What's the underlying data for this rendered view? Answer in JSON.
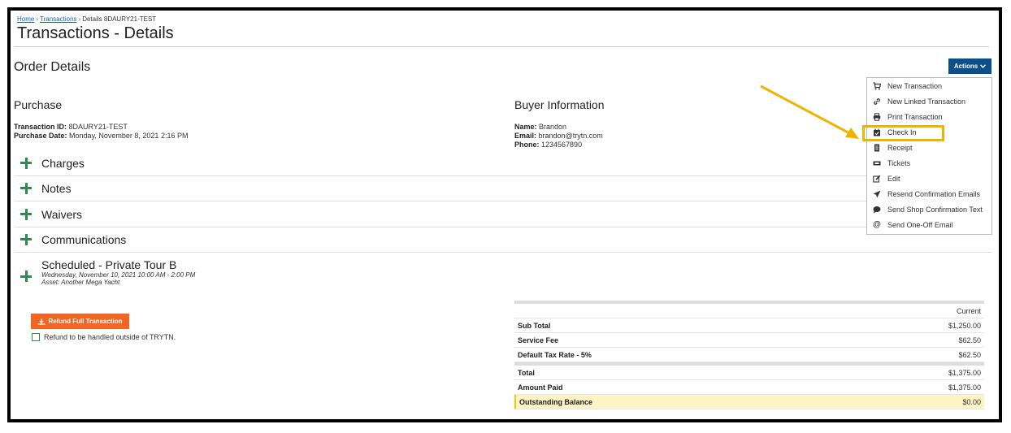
{
  "breadcrumb": {
    "home": "Home",
    "transactions": "Transactions",
    "current": "Details 8DAURY21-TEST"
  },
  "page_title": "Transactions - Details",
  "order_title": "Order Details",
  "actions_label": "Actions",
  "purchase": {
    "title": "Purchase",
    "transaction_id_label": "Transaction ID:",
    "transaction_id": "8DAURY21-TEST",
    "purchase_date_label": "Purchase Date:",
    "purchase_date": "Monday, November 8, 2021 2:16 PM"
  },
  "buyer": {
    "title": "Buyer Information",
    "name_label": "Name:",
    "name": "Brandon",
    "email_label": "Email:",
    "email": "brandon@trytn.com",
    "phone_label": "Phone:",
    "phone": "1234567890"
  },
  "sections": [
    "Charges",
    "Notes",
    "Waivers",
    "Communications"
  ],
  "scheduled": {
    "title": "Scheduled - Private Tour B",
    "date": "Wednesday, November 10, 2021 10:00 AM - 2:00 PM",
    "asset": "Asset: Another Mega Yacht"
  },
  "refund": {
    "button": "Refund Full Transaction",
    "checkbox_label": "Refund to be handled outside of TRYTN."
  },
  "summary": {
    "column": "Current",
    "rows": [
      {
        "label": "Sub Total",
        "value": "$1,250.00"
      },
      {
        "label": "Service Fee",
        "value": "$62.50"
      },
      {
        "label": "Default Tax Rate - 5%",
        "value": "$62.50"
      },
      {
        "label": "Total",
        "value": "$1,375.00"
      },
      {
        "label": "Amount Paid",
        "value": "$1,375.00"
      },
      {
        "label": "Outstanding Balance",
        "value": "$0.00"
      }
    ]
  },
  "menu": [
    {
      "label": "New Transaction",
      "icon": "cart-icon"
    },
    {
      "label": "New Linked Transaction",
      "icon": "link-icon"
    },
    {
      "label": "Print Transaction",
      "icon": "printer-icon"
    },
    {
      "label": "Check In",
      "icon": "calendar-check-icon"
    },
    {
      "label": "Receipt",
      "icon": "receipt-icon"
    },
    {
      "label": "Tickets",
      "icon": "ticket-icon"
    },
    {
      "label": "Edit",
      "icon": "edit-icon"
    },
    {
      "label": "Resend Confirmation Emails",
      "icon": "send-icon"
    },
    {
      "label": "Send Shop Confirmation Text",
      "icon": "chat-icon"
    },
    {
      "label": "Send One-Off Email",
      "icon": "at-icon"
    }
  ],
  "colors": {
    "primary": "#0b4f8a",
    "refund": "#f26522",
    "plus": "#2e8b4f",
    "highlight_border": "#f0b400",
    "balance_bg": "#fdf3c5"
  }
}
